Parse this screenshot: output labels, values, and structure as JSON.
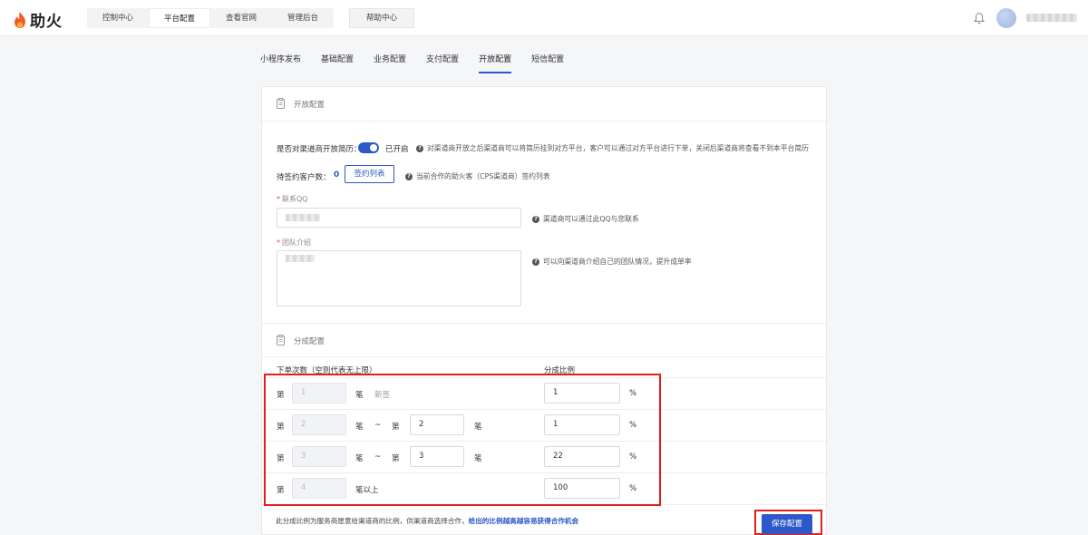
{
  "brand": {
    "name": "助火"
  },
  "topnav": {
    "items": [
      "控制中心",
      "平台配置",
      "查看官网",
      "管理后台"
    ],
    "active_index": 1,
    "help": "帮助中心"
  },
  "subtabs": {
    "items": [
      "小程序发布",
      "基础配置",
      "业务配置",
      "支付配置",
      "开放配置",
      "短信配置"
    ],
    "active_index": 4
  },
  "open_config": {
    "section_title": "开放配置",
    "resume_label": "是否对渠道商开放简历：",
    "toggle_state": "已开启",
    "toggle_on": true,
    "resume_hint": "对渠道商开放之后渠道商可以将简历挂到对方平台，客户可以通过对方平台进行下单，关闭后渠道商将查看不到本平台简历",
    "pending_label": "待签约客户数：",
    "pending_count": "0",
    "sign_list_button": "签约列表",
    "pending_hint": "当前合作的助火客（CPS渠道商）签约列表",
    "qq_label": "联系QQ",
    "qq_hint": "渠道商可以通过此QQ与您联系",
    "team_label": "团队介绍",
    "team_hint": "可以向渠道商介绍自己的团队情况，提升成单率"
  },
  "commission_config": {
    "section_title": "分成配置",
    "col_orders": "下单次数（空则代表无上限）",
    "col_ratio": "分成比例",
    "prefix": "第",
    "suffix": "笔",
    "range_sep": "~",
    "rows": [
      {
        "from": "1",
        "tail": "新签",
        "ratio": "1",
        "unit": "%"
      },
      {
        "from": "2",
        "to": "2",
        "ratio": "1",
        "unit": "%"
      },
      {
        "from": "3",
        "to": "3",
        "ratio": "22",
        "unit": "%"
      },
      {
        "from": "4",
        "tail": "笔以上",
        "ratio": "100",
        "unit": "%"
      }
    ]
  },
  "footer": {
    "note_prefix": "此分成比例为服务商愿意给渠道商的比例，供渠道商选择合作，",
    "note_emphasis": "给出的比例越高越容易获得合作机会",
    "save_button": "保存配置"
  }
}
